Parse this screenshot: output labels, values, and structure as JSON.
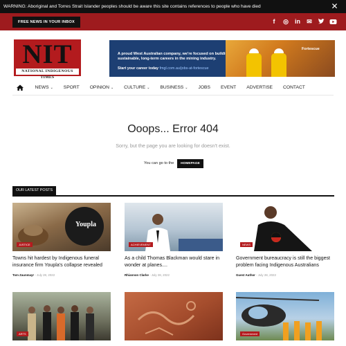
{
  "warning": {
    "text": "WARNING: Aboriginal and Torres Strait Islander peoples should be aware this site contains references to people who have died",
    "close_glyph": "✕"
  },
  "topbar": {
    "inbox_label": "FREE NEWS IN YOUR INBOX",
    "social": [
      {
        "icon": "facebook-icon",
        "glyph": "f"
      },
      {
        "icon": "instagram-icon",
        "glyph": "◎"
      },
      {
        "icon": "linkedin-icon",
        "glyph": "in"
      },
      {
        "icon": "email-icon",
        "glyph": "✉"
      },
      {
        "icon": "twitter-icon",
        "glyph": "🐦"
      },
      {
        "icon": "youtube-icon",
        "glyph": "▶"
      }
    ]
  },
  "logo": {
    "letters": "NIT",
    "subtitle": "NATIONAL INDIGENOUS TIMES"
  },
  "banner": {
    "line1": "A proud West Australian company, we're focused on building sustainable, long-term careers in the mining industry.",
    "line2_prefix": "Start your career today ",
    "line2_url": "fmgl.com.au/jobs-at-fortescue",
    "brand": "Fortescue"
  },
  "nav": {
    "home_icon": "home-icon",
    "items": [
      {
        "label": "NEWS",
        "caret": true
      },
      {
        "label": "SPORT",
        "caret": false
      },
      {
        "label": "OPINION",
        "caret": true
      },
      {
        "label": "CULTURE",
        "caret": true
      },
      {
        "label": "BUSINESS",
        "caret": true
      },
      {
        "label": "JOBS",
        "caret": false
      },
      {
        "label": "EVENT",
        "caret": false
      },
      {
        "label": "ADVERTISE",
        "caret": false
      },
      {
        "label": "CONTACT",
        "caret": false
      }
    ]
  },
  "error": {
    "title": "Ooops... Error 404",
    "subtitle": "Sorry, but the page you are looking for doesn't exist.",
    "goto_text": "You can go to the",
    "homepage_label": "HOMEPAGE"
  },
  "latest": {
    "heading": "OUR LATEST POSTS",
    "posts": [
      {
        "category": "JUSTICE",
        "title": "Towns hit hardest by Indigenous funeral insurance firm Youpla's collapse revealed",
        "author": "Tom Zaunmayr",
        "date": "July 28, 2022",
        "logo_text": "Youpla"
      },
      {
        "category": "ACHIEVEMENT",
        "title": "As a child Thomas Blackman would stare in wonder at planes....",
        "author": "Rhiannon Clarke",
        "date": "July 28, 2022"
      },
      {
        "category": "NEWS",
        "title": "Government bureaucracy is still the biggest problem facing Indigenous Australians",
        "author": "Guest Author",
        "date": "July 28, 2022"
      },
      {
        "category": "ARTS",
        "title": "",
        "author": "",
        "date": ""
      },
      {
        "category": "",
        "title": "",
        "author": "",
        "date": ""
      },
      {
        "category": "Government",
        "title": "",
        "author": "",
        "date": ""
      }
    ]
  }
}
